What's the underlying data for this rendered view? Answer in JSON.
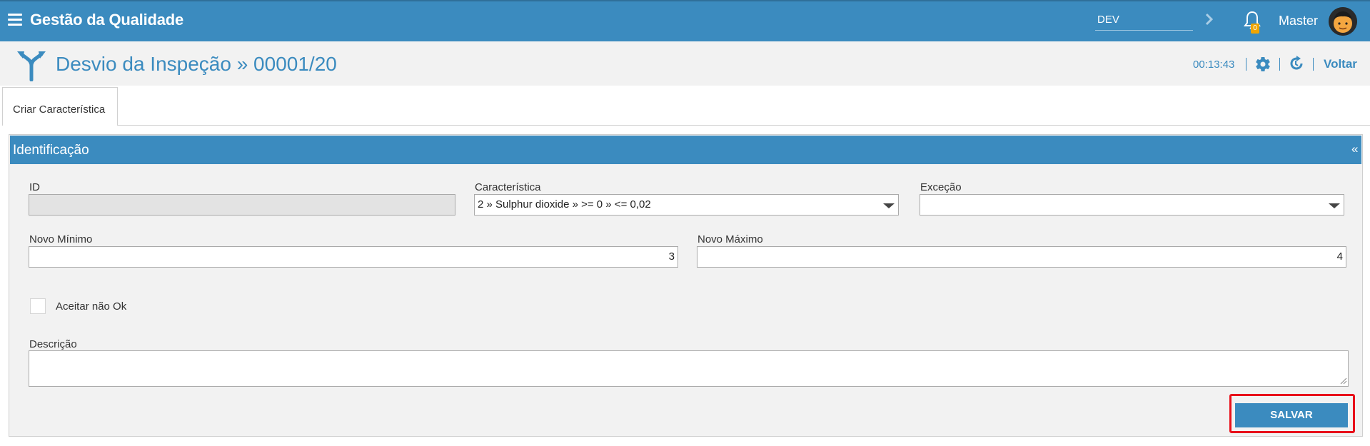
{
  "header": {
    "title": "Gestão da Qualidade",
    "environment": "DEV",
    "notifications_count": "0",
    "user_name": "Master"
  },
  "subheader": {
    "title": "Desvio da Inspeção » 00001/20",
    "timer": "00:13:43",
    "back_label": "Voltar"
  },
  "tabs": [
    {
      "label": "Criar Característica"
    }
  ],
  "panel": {
    "title": "Identificação",
    "collapse_glyph": "«",
    "fields": {
      "id": {
        "label": "ID",
        "value": ""
      },
      "caracteristica": {
        "label": "Característica",
        "value": "2 » Sulphur dioxide » >= 0 » <= 0,02"
      },
      "excecao": {
        "label": "Exceção",
        "value": ""
      },
      "novo_minimo": {
        "label": "Novo Mínimo",
        "value": "3"
      },
      "novo_maximo": {
        "label": "Novo Máximo",
        "value": "4"
      },
      "aceitar_nao_ok": {
        "label": "Aceitar não Ok",
        "checked": false
      },
      "descricao": {
        "label": "Descrição",
        "value": ""
      }
    },
    "save_label": "SALVAR"
  },
  "colors": {
    "primary": "#3b8bbf",
    "highlight": "#e8101a",
    "badge": "#f0a500"
  },
  "icons": [
    "menu-icon",
    "chevron-right-icon",
    "bell-icon",
    "fork-icon",
    "gear-icon",
    "refresh-icon"
  ]
}
